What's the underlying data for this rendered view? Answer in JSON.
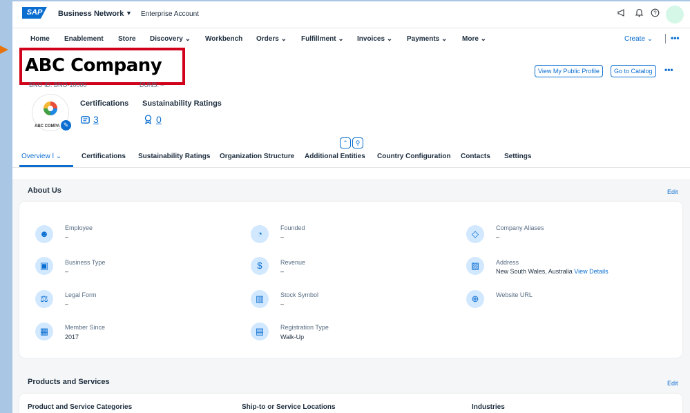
{
  "shell": {
    "logo": "SAP",
    "product": "Business Network",
    "product_caret": "▼",
    "account": "Enterprise Account",
    "icons": [
      "megaphone-icon",
      "bell-icon",
      "help-icon"
    ]
  },
  "nav": {
    "items": [
      {
        "label": "Home"
      },
      {
        "label": "Enablement"
      },
      {
        "label": "Store"
      },
      {
        "label": "Discovery ⌄"
      },
      {
        "label": "Workbench"
      },
      {
        "label": "Orders ⌄"
      },
      {
        "label": "Fulfillment ⌄"
      },
      {
        "label": "Invoices ⌄"
      },
      {
        "label": "Payments ⌄"
      },
      {
        "label": "More ⌄"
      }
    ],
    "create": "Create ⌄",
    "more": "•••"
  },
  "header": {
    "title": "ABC Company",
    "bno_id": "BNO ID: BNO-10000",
    "duns": "DUNS: –",
    "view_profile": "View My Public Profile",
    "go_catalog": "Go to Catalog",
    "more": "•••",
    "logo_text": "ABC COMPA",
    "certifications_label": "Certifications",
    "certifications_value": "3",
    "sustainability_label": "Sustainability Ratings",
    "sustainability_value": "0"
  },
  "tabs": [
    {
      "label": "Overview ǀ ⌄"
    },
    {
      "label": "Certifications"
    },
    {
      "label": "Sustainability Ratings"
    },
    {
      "label": "Organization Structure"
    },
    {
      "label": "Additional Entities"
    },
    {
      "label": "Country Configuration"
    },
    {
      "label": "Contacts"
    },
    {
      "label": "Settings"
    }
  ],
  "about": {
    "title": "About Us",
    "edit": "Edit",
    "fields": {
      "employee": {
        "label": "Employee",
        "value": "–"
      },
      "founded": {
        "label": "Founded",
        "value": "–"
      },
      "aliases": {
        "label": "Company Aliases",
        "value": "–"
      },
      "business_type": {
        "label": "Business Type",
        "value": "–"
      },
      "revenue": {
        "label": "Revenue",
        "value": "–"
      },
      "address": {
        "label": "Address",
        "value": "New South Wales, Australia",
        "link": "View Details"
      },
      "legal_form": {
        "label": "Legal Form",
        "value": "–"
      },
      "stock_symbol": {
        "label": "Stock Symbol",
        "value": "–"
      },
      "website": {
        "label": "Website URL",
        "value": ""
      },
      "member_since": {
        "label": "Member Since",
        "value": "2017"
      },
      "registration_type": {
        "label": "Registration Type",
        "value": "Walk-Up"
      }
    }
  },
  "products": {
    "title": "Products and Services",
    "edit": "Edit",
    "col1": "Product and Service Categories",
    "col2": "Ship-to or Service Locations",
    "col3": "Industries"
  }
}
